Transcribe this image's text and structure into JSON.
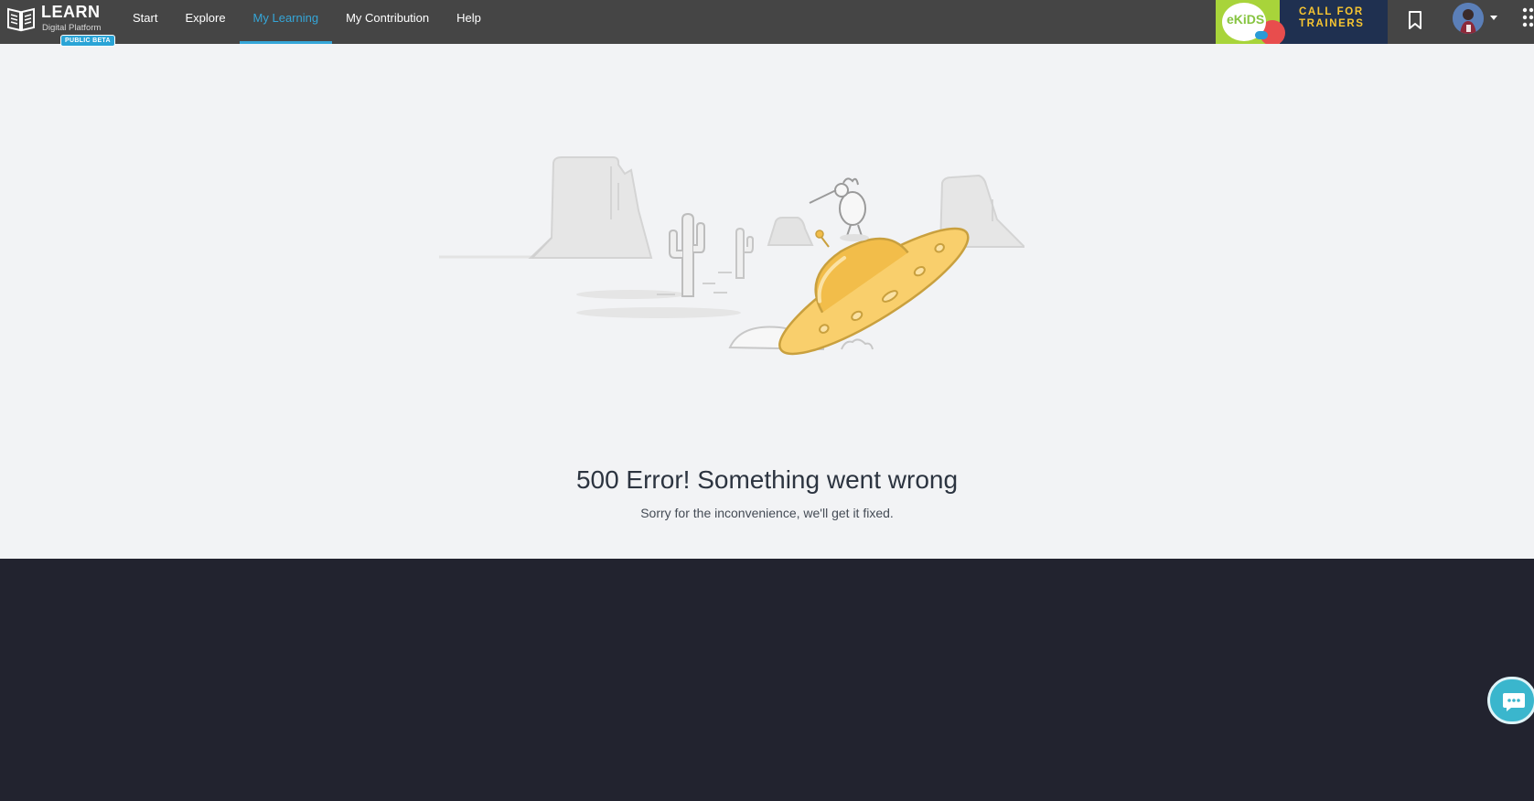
{
  "brand": {
    "title": "LEARN",
    "subtitle": "Digital Platform",
    "badge": "PUBLIC BETA"
  },
  "nav": {
    "items": [
      {
        "label": "Start"
      },
      {
        "label": "Explore"
      },
      {
        "label": "My Learning",
        "active": true
      },
      {
        "label": "My Contribution"
      },
      {
        "label": "Help"
      }
    ]
  },
  "ad": {
    "brand": "eKiDS",
    "line1": "CALL FOR",
    "line2": "TRAINERS"
  },
  "header_icons": [
    "bookmark-icon",
    "avatar",
    "chevron-down-icon",
    "apps-grid-icon"
  ],
  "error": {
    "title": "500 Error! Something went wrong",
    "message": "Sorry for the inconvenience, we'll get it fixed."
  },
  "chat": {
    "icon": "chat-bubble-icon"
  },
  "colors": {
    "topbar": "#454545",
    "accent": "#35a6d8",
    "page_background": "#f2f3f5",
    "footer": "#22232f",
    "ufo": "#fbd27a",
    "chat_button": "#3ab6cd"
  }
}
